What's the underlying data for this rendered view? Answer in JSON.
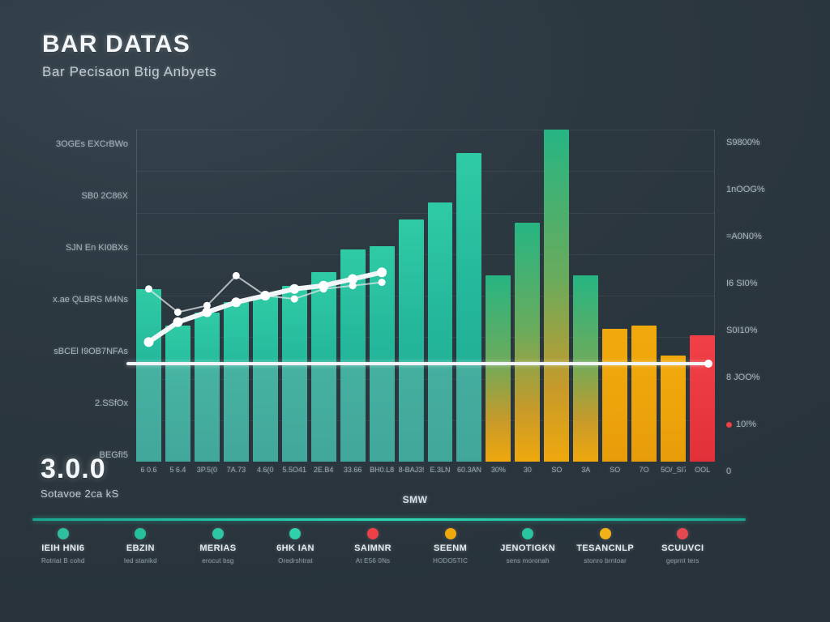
{
  "header": {
    "title": "BAR DATAS",
    "subtitle": "Bar Pecisaon Btig Anbyets"
  },
  "value_block": {
    "value": "3.0.0",
    "caption": "Sotavoe 2ca kS"
  },
  "x_axis_title": "SMW",
  "colors": {
    "background": "#2c3840",
    "teal": "#24b79b",
    "teal_bright": "#2fd9b5",
    "amber": "#f0a90c",
    "red": "#ef4048",
    "gray_shade": "#96a5af",
    "line_white": "#f2f5f7",
    "grid": "#bec d7",
    "text": "#e8edf0"
  },
  "chart_data": {
    "type": "bar",
    "title": "BAR DATAS",
    "subtitle": "Bar Pecisaon Btig Anbyets",
    "xlabel": "SMW",
    "ylabel": "",
    "grid": true,
    "legend_position": "bottom",
    "ylim": [
      0,
      100
    ],
    "categories": [
      "6 0.6",
      "5 6.4",
      "3P.5(0",
      "7A.73",
      "4.6(0",
      "5.5O41",
      "2E.B4",
      "33.66",
      "BH0.L8",
      "8-BAJ39",
      "E.3LN",
      "60.3AN",
      "30%",
      "30",
      "SO",
      "3A",
      "SO",
      "7O",
      "5O/_SI7",
      "OOL"
    ],
    "values": [
      52,
      41,
      45,
      48,
      50,
      53,
      57,
      64,
      65,
      73,
      78,
      93,
      56,
      72,
      100,
      56,
      40,
      41,
      32,
      38
    ],
    "bar_styles": [
      "teal",
      "teal",
      "teal",
      "teal",
      "teal",
      "teal",
      "teal",
      "teal",
      "teal",
      "teal",
      "teal",
      "teal",
      "grad",
      "grad",
      "grad",
      "grad",
      "amber",
      "amber",
      "amber",
      "red"
    ],
    "shaded_below_threshold": [
      true,
      true,
      true,
      true,
      true,
      true,
      true,
      true,
      true,
      true,
      true,
      true,
      false,
      false,
      false,
      false,
      false,
      false,
      false,
      false
    ],
    "threshold": {
      "value": 30,
      "label": "",
      "color": "#f2f5f7"
    },
    "series": [
      {
        "name": "trend-thick",
        "type": "line",
        "color": "#f2f5f7",
        "width": 6,
        "x": [
          0,
          1,
          2,
          3,
          4,
          5,
          6,
          7,
          8
        ],
        "values": [
          36,
          42,
          45,
          48,
          50,
          52,
          53,
          55,
          57
        ]
      },
      {
        "name": "trend-thin",
        "type": "line",
        "color": "#dfe6ea",
        "width": 2,
        "x": [
          0,
          1,
          2,
          3,
          4,
          5,
          6,
          7,
          8
        ],
        "values": [
          52,
          45,
          47,
          56,
          50,
          49,
          52,
          53,
          54
        ]
      }
    ],
    "y_axis_left_ticks": [
      "3OGEs EXCrBWo",
      "SB0 2C86X",
      "SJN En KI0BXs",
      "x.ae QLBRS M4Ns",
      "sBCEl I9OB7NFAs",
      "2.SSfOx",
      "BEGfI5"
    ],
    "y_axis_right_ticks": [
      "S9800%",
      "1nOOG%",
      "=A0N0%",
      "I6 SI0%",
      "S0I10%",
      "8 JOO%",
      "10!%",
      "0"
    ],
    "y_axis_right_marked": [
      false,
      false,
      false,
      false,
      false,
      false,
      true,
      false
    ]
  },
  "legend": {
    "items": [
      {
        "label": "IEIH HNI6",
        "sub": "Rotriat B cohd",
        "color": "#2fbfa0"
      },
      {
        "label": "EBZIN",
        "sub": "Ied stanikd",
        "color": "#25c09c"
      },
      {
        "label": "MERIAS",
        "sub": "erocut bsg",
        "color": "#2fc6a5"
      },
      {
        "label": "6HK IAN",
        "sub": "Oredrshtrat",
        "color": "#2fd0ac"
      },
      {
        "label": "SAIMNR",
        "sub": "At E56 0Ns",
        "color": "#ef4048"
      },
      {
        "label": "SEENM",
        "sub": "HODO5TIC",
        "color": "#f0a90c"
      },
      {
        "label": "JENOTIGKN",
        "sub": "sens moronah",
        "color": "#28c3a0"
      },
      {
        "label": "TESANCNLP",
        "sub": "stonro brntoar",
        "color": "#f0b216"
      },
      {
        "label": "SCUUVCI",
        "sub": "geprnt ters",
        "color": "#e5484f"
      }
    ]
  }
}
